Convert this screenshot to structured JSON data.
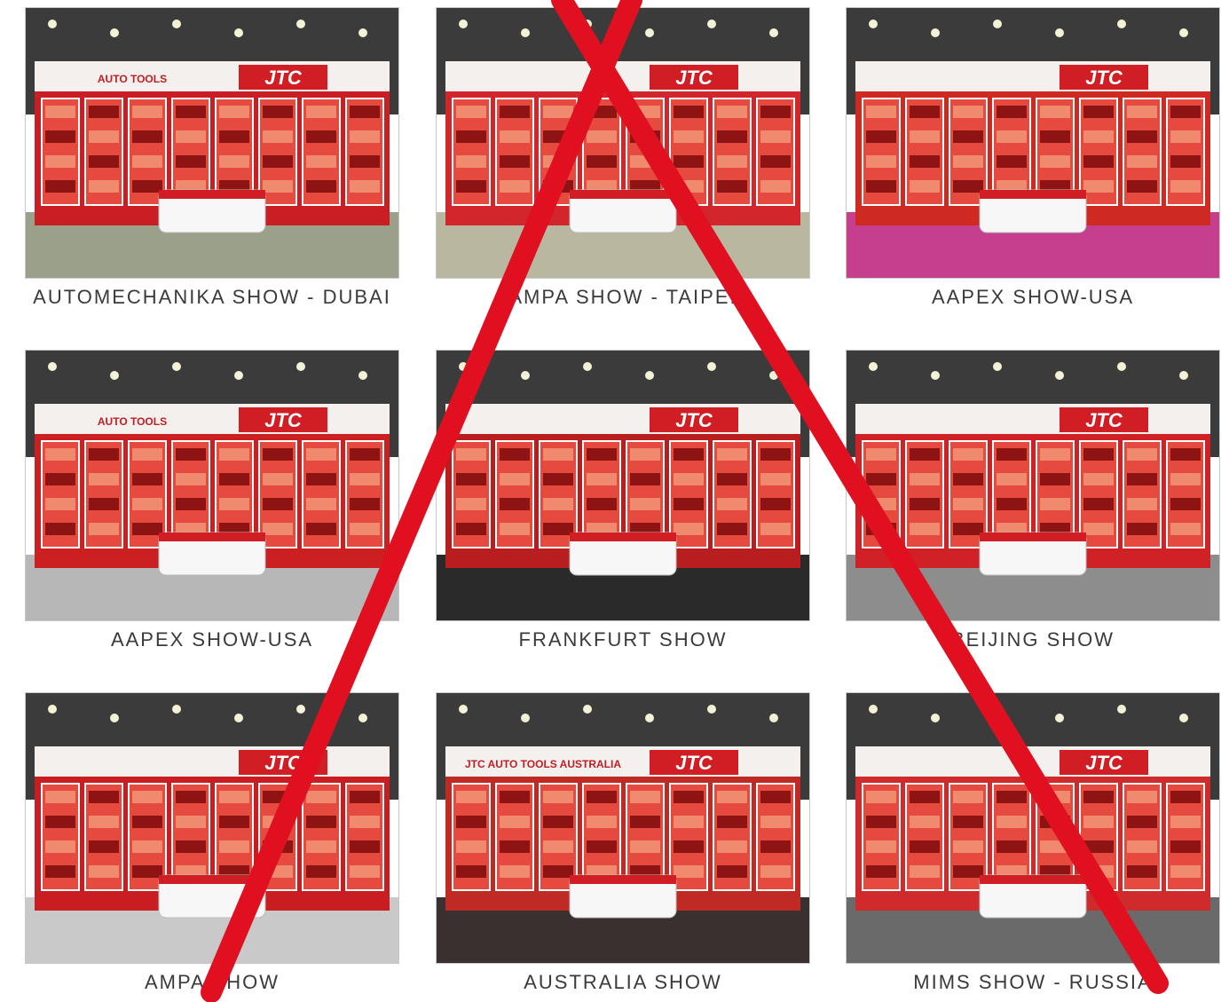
{
  "panels": [
    {
      "caption": "AUTOMECHANIKA SHOW - DUBAI",
      "logo": "JTC",
      "sign": "AUTO TOOLS",
      "floor": "#9aa08a",
      "wall": "#c91f24"
    },
    {
      "caption": "AMPA SHOW - TAIPEI",
      "logo": "JTC",
      "sign": "",
      "floor": "#b9b79f",
      "wall": "#d1262b"
    },
    {
      "caption": "AAPEX SHOW-USA",
      "logo": "JTC",
      "sign": "",
      "floor": "#c63e8e",
      "wall": "#cf2a22"
    },
    {
      "caption": "AAPEX SHOW-USA",
      "logo": "JTC",
      "sign": "AUTO TOOLS",
      "floor": "#b7b7b7",
      "wall": "#cc1f22"
    },
    {
      "caption": "FRANKFURT SHOW",
      "logo": "JTC",
      "sign": "",
      "floor": "#2a2a2a",
      "wall": "#b81d1f"
    },
    {
      "caption": "BEIJING SHOW",
      "logo": "JTC",
      "sign": "",
      "floor": "#8d8d8d",
      "wall": "#d02226"
    },
    {
      "caption": "AMPA SHOW",
      "logo": "JTC",
      "sign": "",
      "floor": "#c9c9c9",
      "wall": "#c91d22"
    },
    {
      "caption": "AUSTRALIA SHOW",
      "logo": "JTC",
      "sign": "JTC AUTO TOOLS AUSTRALIA",
      "floor": "#3a3030",
      "wall": "#c02a25"
    },
    {
      "caption": "MIMS SHOW - RUSSIA",
      "logo": "JTC",
      "sign": "",
      "floor": "#6a6a6a",
      "wall": "#cf2a2c"
    }
  ],
  "overlay": {
    "mark": "crossed-out-x",
    "color": "#e01020"
  }
}
